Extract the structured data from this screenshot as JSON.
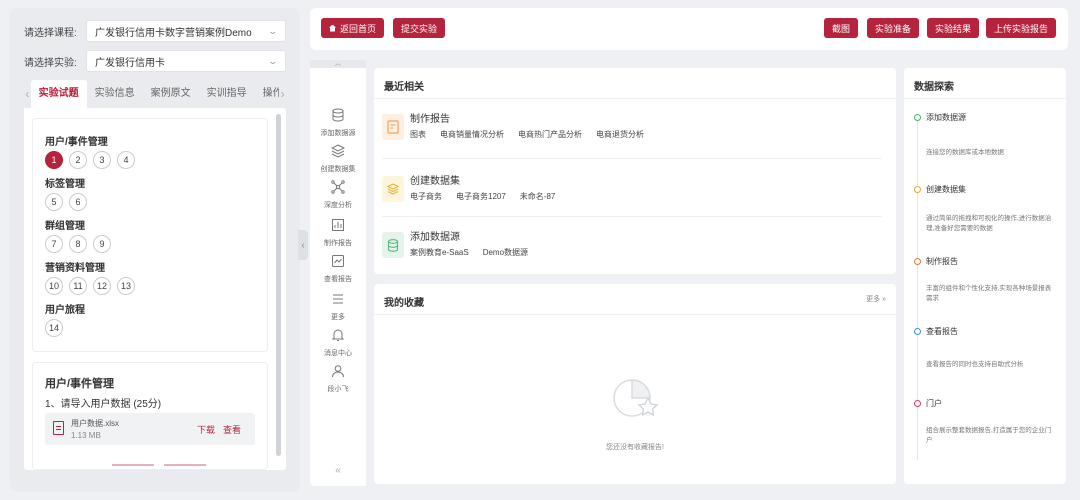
{
  "left": {
    "course_label": "请选择课程:",
    "course_value": "广发银行信用卡数字营销案例Demo",
    "experiment_label": "请选择实验:",
    "experiment_value": "广发银行信用卡",
    "tabs": [
      "实验试题",
      "实验信息",
      "案例原文",
      "实训指导",
      "操作视频"
    ],
    "active_tab": "实验试题",
    "categories": [
      {
        "name": "用户/事件管理",
        "numbers": [
          "1",
          "2",
          "3",
          "4"
        ]
      },
      {
        "name": "标签管理",
        "numbers": [
          "5",
          "6"
        ]
      },
      {
        "name": "群组管理",
        "numbers": [
          "7",
          "8",
          "9"
        ]
      },
      {
        "name": "营销资料管理",
        "numbers": [
          "10",
          "11",
          "12",
          "13"
        ]
      },
      {
        "name": "用户旅程",
        "numbers": [
          "14"
        ]
      }
    ],
    "active_number": "1",
    "detail": {
      "title": "用户/事件管理",
      "question": "1、请导入用户数据 (25分)",
      "file_name": "用户数据.xlsx",
      "file_size": "1.13 MB",
      "download": "下载",
      "view": "查看"
    }
  },
  "toolbar": {
    "home": "返回首页",
    "submit": "提交实验",
    "screenshot": "截图",
    "prepare": "实验准备",
    "result": "实验结果",
    "upload": "上传实验报告"
  },
  "rail": {
    "items": [
      {
        "label": "添加数据源",
        "icon": "database-icon"
      },
      {
        "label": "创建数据集",
        "icon": "layers-icon"
      },
      {
        "label": "深度分析",
        "icon": "network-icon"
      },
      {
        "label": "制作报告",
        "icon": "chart-icon"
      },
      {
        "label": "查看报告",
        "icon": "report-icon"
      },
      {
        "label": "更多",
        "icon": "menu-icon"
      },
      {
        "label": "消息中心",
        "icon": "bell-icon"
      },
      {
        "label": "段小飞",
        "icon": "user-icon"
      }
    ]
  },
  "recent": {
    "title": "最近相关",
    "items": [
      {
        "title": "制作报告",
        "subs": [
          "图表",
          "电商销量情况分析",
          "电商热门产品分析",
          "电商退货分析"
        ],
        "color": "#f0a35a",
        "bg": "#fdf0e3"
      },
      {
        "title": "创建数据集",
        "subs": [
          "电子商务",
          "电子商务1207",
          "未命名-87"
        ],
        "color": "#e6b43c",
        "bg": "#fdf5dc"
      },
      {
        "title": "添加数据源",
        "subs": [
          "案例教育e-SaaS",
          "Demo数据源"
        ],
        "color": "#5bb27a",
        "bg": "#e4f4ea"
      }
    ]
  },
  "favorites": {
    "title": "我的收藏",
    "more": "更多 »",
    "empty": "您还没有收藏报告!"
  },
  "explore": {
    "title": "数据探索",
    "steps": [
      {
        "title": "添加数据源",
        "desc": "连接您的数据库或本地数据",
        "color": "#4caf73"
      },
      {
        "title": "创建数据集",
        "desc": "通过简单的拖拽和可视化的操作,进行数据治理,准备好您需要的数据",
        "color": "#e6a43c"
      },
      {
        "title": "制作报告",
        "desc": "丰富的组件和个性化支持,实现各种场景报表需求",
        "color": "#e07a3c"
      },
      {
        "title": "查看报告",
        "desc": "查看报告的同时也支持自助式分析",
        "color": "#3c8fe0"
      },
      {
        "title": "门户",
        "desc": "组合展示整套数据报告,打造属于您的企业门户",
        "color": "#d9405a"
      }
    ]
  }
}
